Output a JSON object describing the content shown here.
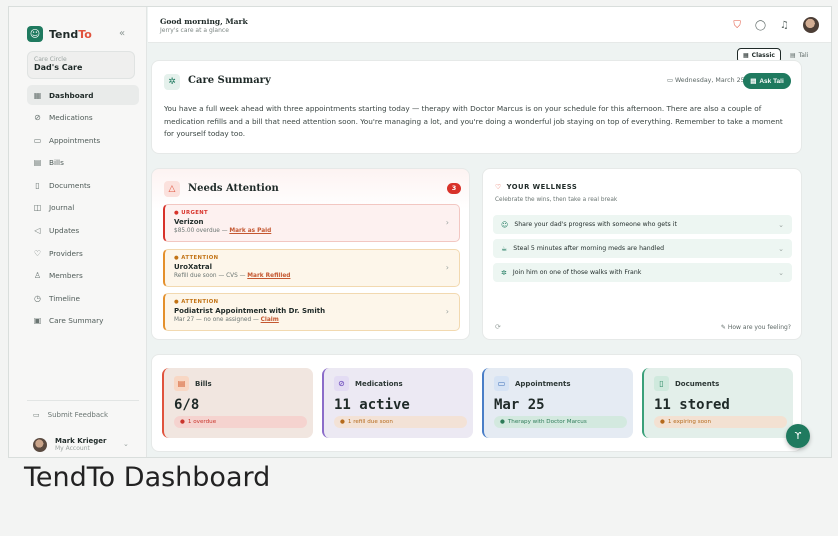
{
  "caption": "TendTo Dashboard",
  "brand": {
    "name_head": "Tend",
    "name_tail": "To"
  },
  "care_circle": {
    "label": "Care Circle",
    "name": "Dad's Care"
  },
  "nav": [
    {
      "label": "Dashboard",
      "icon": "grid-icon"
    },
    {
      "label": "Medications",
      "icon": "pill-icon"
    },
    {
      "label": "Appointments",
      "icon": "calendar-icon"
    },
    {
      "label": "Bills",
      "icon": "receipt-icon"
    },
    {
      "label": "Documents",
      "icon": "file-icon"
    },
    {
      "label": "Journal",
      "icon": "book-icon"
    },
    {
      "label": "Updates",
      "icon": "megaphone-icon"
    },
    {
      "label": "Providers",
      "icon": "stethoscope-icon"
    },
    {
      "label": "Members",
      "icon": "users-icon"
    },
    {
      "label": "Timeline",
      "icon": "clock-icon"
    },
    {
      "label": "Care Summary",
      "icon": "clipboard-icon"
    }
  ],
  "feedback": "Submit Feedback",
  "user": {
    "name": "Mark Krieger",
    "sub": "My Account"
  },
  "header": {
    "greeting": "Good morning, Mark",
    "subtitle": "Jerry's care at a glance"
  },
  "view_toggle": {
    "classic": "Classic",
    "tali": "Tali"
  },
  "summary": {
    "title": "Care Summary",
    "date": "Wednesday, March 25",
    "ask_label": "Ask Tali",
    "text": "You have a full week ahead with three appointments starting today — therapy with Doctor Marcus is on your schedule for this afternoon. There are also a couple of medication refills and a bill that need attention soon. You're managing a lot, and you're doing a wonderful job staying on top of everything. Remember to take a moment for yourself today too."
  },
  "attention": {
    "title": "Needs Attention",
    "count": "3",
    "items": [
      {
        "tag": "● URGENT",
        "name": "Verizon",
        "sub": "$85.00 overdue — ",
        "link": "Mark as Paid"
      },
      {
        "tag": "● ATTENTION",
        "name": "UroXatral",
        "sub": "Refill due soon — CVS — ",
        "link": "Mark Refilled"
      },
      {
        "tag": "● ATTENTION",
        "name": "Podiatrist Appointment with Dr. Smith",
        "sub": "Mar 27 — no one assigned — ",
        "link": "Claim"
      }
    ]
  },
  "wellness": {
    "title": "YOUR WELLNESS",
    "subtitle": "Celebrate the wins, then take a real break",
    "items": [
      "Share your dad's progress with someone who gets it",
      "Steal 5 minutes after morning meds are handled",
      "Join him on one of those walks with Frank"
    ],
    "feel": "How are you feeling?"
  },
  "stats": {
    "bills": {
      "label": "Bills",
      "value": "6/8",
      "badge": "1 overdue"
    },
    "meds": {
      "label": "Medications",
      "value": "11 active",
      "badge": "1 refill due soon"
    },
    "appts": {
      "label": "Appointments",
      "value": "Mar 25",
      "badge": "Therapy with Doctor Marcus"
    },
    "docs": {
      "label": "Documents",
      "value": "11 stored",
      "badge": "1 expiring soon"
    }
  },
  "colors": {
    "brand_green": "#1f7a5f",
    "accent_red": "#e0533d",
    "urgent_red": "#d8322a",
    "attention_orange": "#e4902c"
  }
}
